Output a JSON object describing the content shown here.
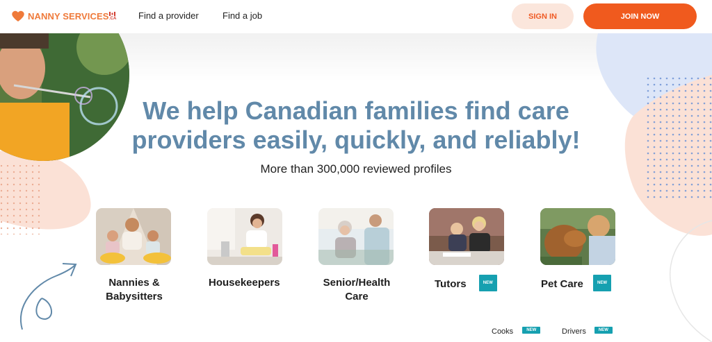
{
  "header": {
    "logo_text": "NANNY SERVICES",
    "logo_suffix": ".CA",
    "nav": [
      {
        "label": "Find a provider"
      },
      {
        "label": "Find a job"
      }
    ],
    "signin_label": "SIGN IN",
    "join_label": "JOIN NOW"
  },
  "hero": {
    "title_line1": "We help Canadian families find care",
    "title_line2": "providers easily, quickly, and reliably!",
    "subtitle": "More than 300,000 reviewed profiles"
  },
  "categories": [
    {
      "label_line1": "Nannies &",
      "label_line2": "Babysitters"
    },
    {
      "label_line1": "Housekeepers",
      "label_line2": ""
    },
    {
      "label_line1": "Senior/Health",
      "label_line2": "Care"
    },
    {
      "label_line1": "Tutors",
      "badge": "NEW"
    },
    {
      "label_line1": "Pet Care",
      "badge": "NEW"
    }
  ],
  "extras": [
    {
      "label": "Cooks",
      "badge": "NEW"
    },
    {
      "label": "Drivers",
      "badge": "NEW"
    }
  ],
  "colors": {
    "accent": "#f05a1e",
    "title": "#6189a9",
    "badge": "#16a0b0"
  }
}
